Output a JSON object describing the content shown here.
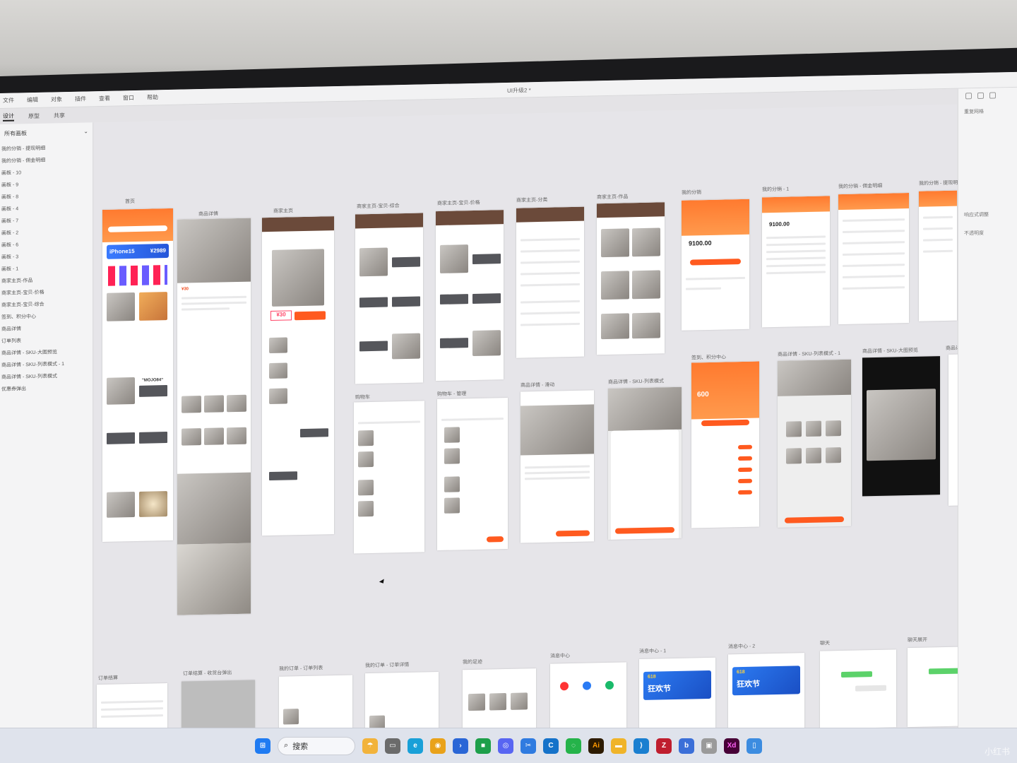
{
  "menubar": {
    "items": [
      "文件",
      "编辑",
      "对象",
      "插件",
      "查看",
      "窗口",
      "帮助"
    ],
    "document_title": "UI升级2 *"
  },
  "modes": [
    "设计",
    "原型",
    "共享"
  ],
  "layers_panel": {
    "header": "所有画板",
    "items": [
      "我的分销 - 提现明细",
      "我的分销 - 佣金明细",
      "画板 - 10",
      "画板 - 9",
      "画板 - 8",
      "画板 - 4",
      "画板 - 7",
      "画板 - 2",
      "画板 - 6",
      "画板 - 3",
      "画板 - 1",
      "商家主页-作品",
      "商家主页-宝贝-价格",
      "商家主页-宝贝-综合",
      "签到、积分中心",
      "商品详情",
      "订单列表",
      "商品详情 - SKU-大图预览",
      "商品详情 - SKU-列表模式 - 1",
      "商品详情 - SKU-列表模式",
      "优惠券弹出"
    ]
  },
  "properties_panel": {
    "items": [
      "重复网格",
      "响应式调整",
      "不透明度"
    ]
  },
  "artboards": {
    "row1": [
      {
        "label": "首页"
      },
      {
        "label": "商品详情"
      },
      {
        "label": "商家主页"
      },
      {
        "label": "商家主页-宝贝-综合"
      },
      {
        "label": "商家主页-宝贝-价格"
      },
      {
        "label": "商家主页-分类"
      },
      {
        "label": "商家主页-作品"
      },
      {
        "label": "我的分销"
      },
      {
        "label": "我的分销 - 1"
      },
      {
        "label": "我的分销 - 佣金明细"
      },
      {
        "label": "我的分销 - 提现明细"
      }
    ],
    "row2": [
      {
        "label": "购物车"
      },
      {
        "label": "购物车 - 管理"
      },
      {
        "label": "商品详情 - 滑动"
      },
      {
        "label": "商品详情 - SKU-列表模式"
      },
      {
        "label": "签到、积分中心"
      },
      {
        "label": "商品详情 - SKU-列表模式 - 1"
      },
      {
        "label": "商品详情 - SKU-大图预览"
      },
      {
        "label": "商品详情 - 优惠券弹"
      }
    ],
    "row3": [
      {
        "label": "订单结算"
      },
      {
        "label": "订单结算 - 收货台弹出"
      },
      {
        "label": "我的订单 - 订单列表"
      },
      {
        "label": "我的订单 - 订单详情"
      },
      {
        "label": "我的足迹"
      },
      {
        "label": "消息中心"
      },
      {
        "label": "消息中心 - 1"
      },
      {
        "label": "消息中心 - 2"
      },
      {
        "label": "聊天"
      },
      {
        "label": "聊天展开"
      }
    ],
    "texts": {
      "home_banner": "iPhone15",
      "home_price": "¥2989",
      "product_name": "\"MOJO84\"",
      "promo_price": "¥30",
      "points_value": "600",
      "distribution_balance": "9100.00",
      "distribution_balance_2": "9100.00",
      "festival": "狂欢节",
      "festival_tag": "618"
    }
  },
  "taskbar": {
    "search_label": "搜索",
    "icons": [
      "windows-icon",
      "search-icon",
      "widgets-icon",
      "file-manager-icon",
      "edge-icon",
      "chrome-icon",
      "terminal-icon",
      "xbox-icon",
      "discord-icon",
      "snip-icon",
      "browser-icon",
      "wechat-icon",
      "illustrator-icon",
      "folder-icon",
      "vscode-icon",
      "filezilla-icon",
      "app-icon",
      "photo-icon",
      "xd-icon",
      "phone-icon"
    ]
  },
  "watermark": "小红书",
  "colors": {
    "accent": "#ff5a1f",
    "xd_purple": "#470137",
    "canvas": "#e6e5e9"
  }
}
